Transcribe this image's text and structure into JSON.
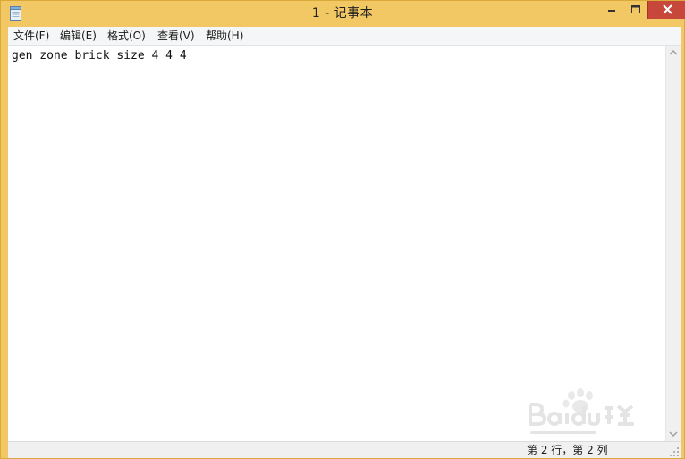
{
  "window": {
    "title": "1 - 记事本",
    "icon": "notepad-icon"
  },
  "menu": [
    {
      "label": "文件(F)"
    },
    {
      "label": "编辑(E)"
    },
    {
      "label": "格式(O)"
    },
    {
      "label": "查看(V)"
    },
    {
      "label": "帮助(H)"
    }
  ],
  "editor": {
    "text": "gen zone brick size 4 4 4"
  },
  "status": {
    "position": "第 2 行，第 2 列"
  },
  "colors": {
    "frame": "#f2c864",
    "close_button": "#c7483b",
    "editor_bg": "#ffffff"
  },
  "watermark": {
    "icon": "baidu-jingyan-watermark"
  }
}
